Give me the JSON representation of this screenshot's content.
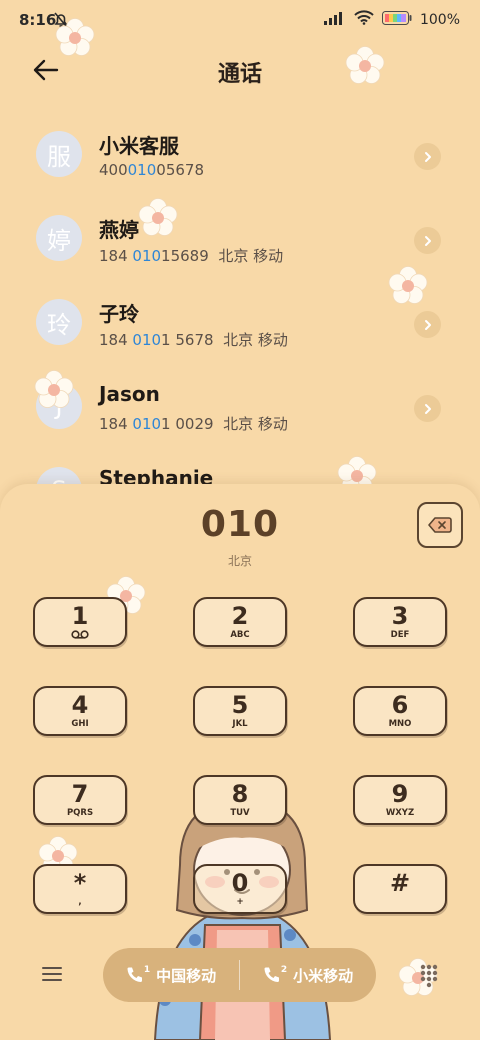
{
  "status_bar": {
    "time": "8:16",
    "battery": "100%"
  },
  "header": {
    "title": "通话",
    "back_icon": "back-arrow-icon"
  },
  "contacts": [
    {
      "avatar": "服",
      "name": "小米客服",
      "number_pre": "400",
      "number_hl": "010",
      "number_post": "05678",
      "location": ""
    },
    {
      "avatar": "婷",
      "name": "燕婷",
      "number_pre": "184 ",
      "number_hl": "010",
      "number_post": "15689",
      "location": "北京 移动"
    },
    {
      "avatar": "玲",
      "name": "子玲",
      "number_pre": "184 ",
      "number_hl": "010",
      "number_post": "1 5678",
      "location": "北京 移动"
    },
    {
      "avatar": "J",
      "name": "Jason",
      "number_pre": "184 ",
      "number_hl": "010",
      "number_post": "1 0029",
      "location": "北京 移动"
    },
    {
      "avatar": "S",
      "name": "Stephanie",
      "number_pre": "",
      "number_hl": "",
      "number_post": "",
      "location": ""
    }
  ],
  "dialer": {
    "number": "010",
    "location": "北京",
    "keys": [
      {
        "digit": "1",
        "letters": ""
      },
      {
        "digit": "2",
        "letters": "ABC"
      },
      {
        "digit": "3",
        "letters": "DEF"
      },
      {
        "digit": "4",
        "letters": "GHI"
      },
      {
        "digit": "5",
        "letters": "JKL"
      },
      {
        "digit": "6",
        "letters": "MNO"
      },
      {
        "digit": "7",
        "letters": "PQRS"
      },
      {
        "digit": "8",
        "letters": "TUV"
      },
      {
        "digit": "9",
        "letters": "WXYZ"
      },
      {
        "digit": "*",
        "letters": ","
      },
      {
        "digit": "0",
        "letters": "+"
      },
      {
        "digit": "#",
        "letters": ""
      }
    ]
  },
  "bottom_bar": {
    "sim1_label": "中国移动",
    "sim1_index": "1",
    "sim2_label": "小米移动",
    "sim2_index": "2"
  },
  "colors": {
    "background": "#f8d9a8",
    "accent": "#d8b27c",
    "highlight": "#2f86d6",
    "ink": "#4d3726"
  }
}
